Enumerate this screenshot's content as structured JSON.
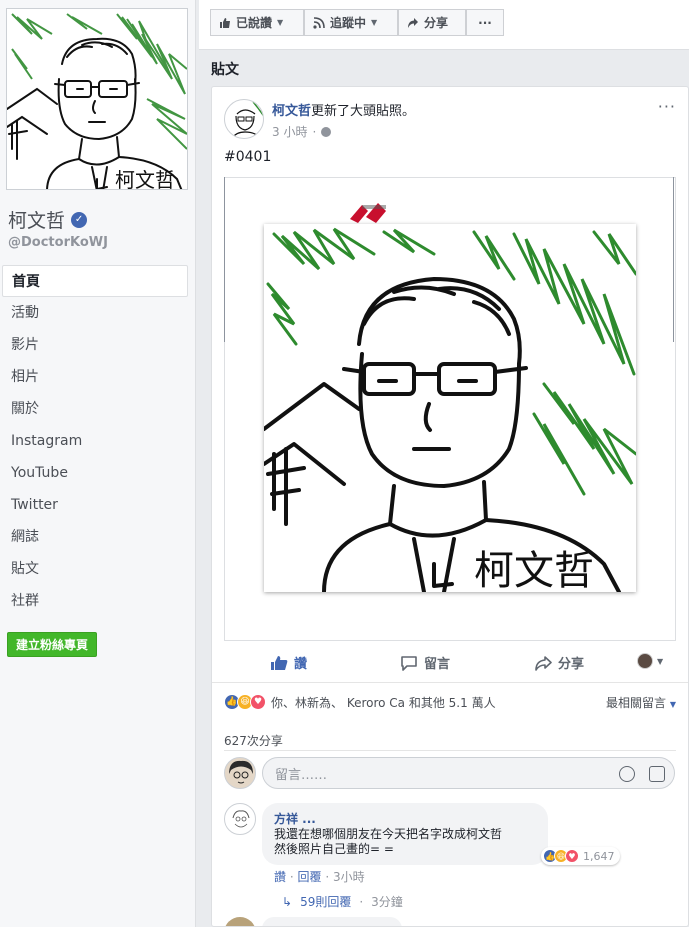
{
  "page": {
    "name": "柯文哲",
    "handle": "@DoctorKoWJ",
    "signature": "柯文哲"
  },
  "nav": {
    "items": [
      "首頁",
      "活動",
      "影片",
      "相片",
      "關於",
      "Instagram",
      "YouTube",
      "Twitter",
      "網誌",
      "貼文",
      "社群"
    ],
    "active_index": 0,
    "create_page_button": "建立粉絲專頁"
  },
  "topbar": {
    "like_button": "已說讚",
    "follow_button": "追蹤中",
    "share_button": "分享",
    "more_button": "···"
  },
  "posts_heading": "貼文",
  "post": {
    "author": "柯文哲",
    "action": "更新了大頭貼照。",
    "time": "3 小時",
    "time_sep": "·",
    "text": "#0401",
    "more": "···",
    "actions": {
      "like": "讚",
      "comment": "留言",
      "share": "分享"
    },
    "reactions": {
      "names": "你、林新為、 Keroro Ca 和其他 5.1 萬人",
      "sort_label": "最相關留言"
    },
    "shares": "627次分享",
    "comment_placeholder": "留言……"
  },
  "comment": {
    "author": "方祥 ...",
    "text": "我還在想哪個朋友在今天把名字改成柯文哲\n然後照片自己畫的= =",
    "reaction_count": "1,647",
    "like_action": "讚",
    "reply_action": "回覆",
    "time": "3小時",
    "replies": "59則回覆",
    "replies_time": "3分鐘"
  },
  "colors": {
    "brand": "#4267b2",
    "link": "#365899",
    "green_button": "#42b72a",
    "page_bg": "#e9ebee",
    "drawing_green": "#2e8b2e"
  }
}
